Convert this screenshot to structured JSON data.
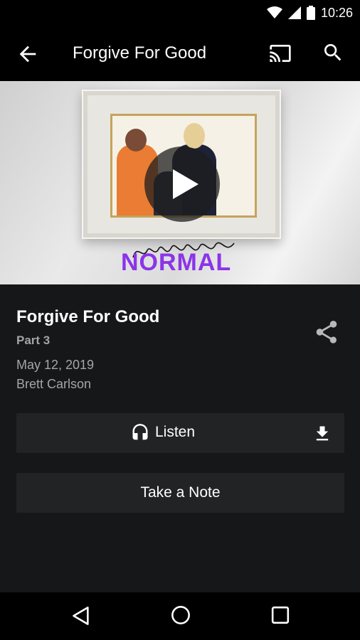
{
  "status_bar": {
    "time": "10:26",
    "icons": [
      "wifi-icon",
      "cell-signal-icon",
      "battery-icon"
    ]
  },
  "app_bar": {
    "title": "Forgive For Good",
    "icons": [
      "back-arrow-icon",
      "cast-icon",
      "search-icon"
    ]
  },
  "hero": {
    "logo_script": "crazy",
    "logo_word": "NORMAL",
    "accent_color": "#8b34e8"
  },
  "message": {
    "title": "Forgive For Good",
    "part": "Part 3",
    "date": "May 12, 2019",
    "speaker": "Brett Carlson"
  },
  "actions": {
    "listen_label": "Listen",
    "note_label": "Take a Note"
  },
  "nav_bar": {
    "icons": [
      "nav-back-icon",
      "nav-home-icon",
      "nav-recents-icon"
    ]
  },
  "colors": {
    "background": "#161718",
    "button_bg": "#222325",
    "muted_text": "#a5a5a5"
  }
}
